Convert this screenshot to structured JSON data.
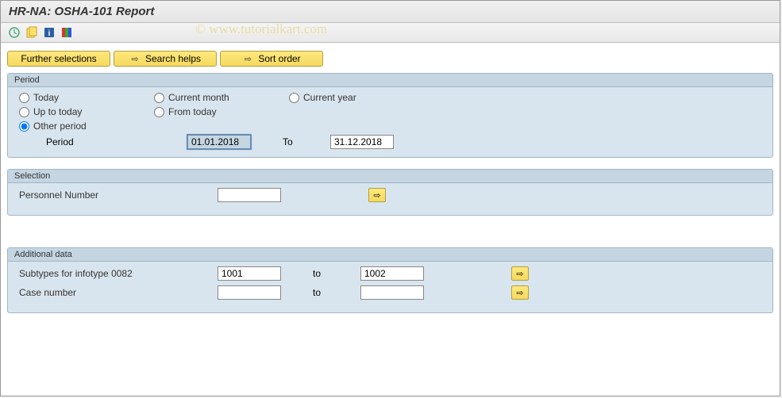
{
  "title": "HR-NA: OSHA-101 Report",
  "watermark": "© www.tutorialkart.com",
  "buttons": {
    "further_selections": "Further selections",
    "search_helps": "Search helps",
    "sort_order": "Sort order"
  },
  "period": {
    "legend": "Period",
    "today": "Today",
    "current_month": "Current month",
    "current_year": "Current year",
    "up_to_today": "Up to today",
    "from_today": "From today",
    "other_period": "Other period",
    "period_label": "Period",
    "from_value": "01.01.2018",
    "to_label": "To",
    "to_value": "31.12.2018"
  },
  "selection": {
    "legend": "Selection",
    "personnel_number": "Personnel Number",
    "personnel_number_value": ""
  },
  "additional": {
    "legend": "Additional data",
    "subtypes_label": "Subtypes for infotype 0082",
    "subtypes_from": "1001",
    "subtypes_to": "1002",
    "case_label": "Case number",
    "case_from": "",
    "case_to": "",
    "to_label": "to"
  }
}
